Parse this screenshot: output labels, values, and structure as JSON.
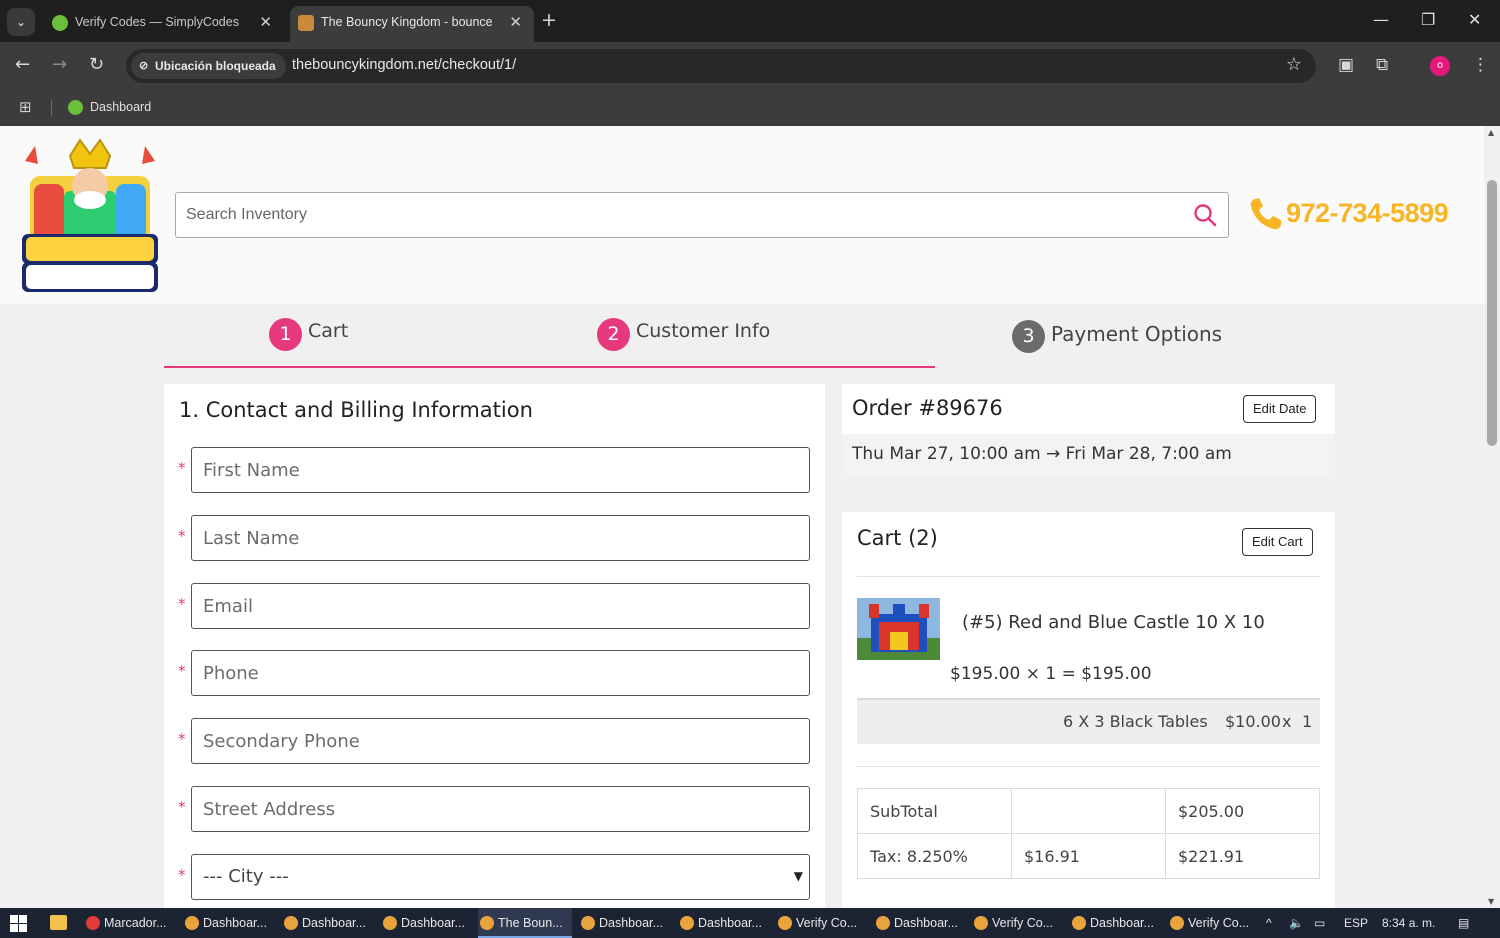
{
  "browser": {
    "tabs": [
      {
        "title": "Verify Codes — SimplyCodes",
        "active": false
      },
      {
        "title": "The Bouncy Kingdom - bounce",
        "active": true
      }
    ],
    "site_chip": "Ubicación bloqueada",
    "url": "thebouncykingdom.net/checkout/1/",
    "bookmark": "Dashboard",
    "profile_initial": "o"
  },
  "header": {
    "search_placeholder": "Search Inventory",
    "phone": "972-734-5899",
    "colors": {
      "accent": "#e6397d",
      "phone": "#f7b523"
    }
  },
  "steps": [
    {
      "num": "1",
      "label": "Cart"
    },
    {
      "num": "2",
      "label": "Customer Info"
    },
    {
      "num": "3",
      "label": "Payment Options"
    }
  ],
  "form": {
    "title": "1. Contact and Billing Information",
    "fields": [
      {
        "placeholder": "First Name",
        "value": ""
      },
      {
        "placeholder": "Last Name",
        "value": ""
      },
      {
        "placeholder": "Email",
        "value": ""
      },
      {
        "placeholder": "Phone",
        "value": ""
      },
      {
        "placeholder": "Secondary Phone",
        "value": ""
      },
      {
        "placeholder": "Street Address",
        "value": ""
      }
    ],
    "city_select": "--- City ---",
    "required_marker": "*"
  },
  "order": {
    "title": "Order #89676",
    "edit_date": "Edit Date",
    "dates": "Thu Mar 27, 10:00 am → Fri Mar 28, 7:00 am"
  },
  "cart": {
    "title": "Cart (2)",
    "edit_cart": "Edit Cart",
    "item": {
      "name": "(#5) Red and Blue Castle 10 X 10",
      "price_line": "$195.00  × 1 =  $195.00"
    },
    "addon": {
      "name": "6 X 3 Black Tables",
      "price": "$10.00",
      "times": "x",
      "qty": "1"
    },
    "totals": [
      [
        "SubTotal",
        "",
        "$205.00"
      ],
      [
        "Tax: 8.250%",
        "$16.91",
        "$221.91"
      ]
    ]
  },
  "taskbar": {
    "items": [
      {
        "label": "Marcador...",
        "active": false,
        "color": "#e03a3a"
      },
      {
        "label": "Dashboar...",
        "active": false,
        "color": "#e8a33c"
      },
      {
        "label": "Dashboar...",
        "active": false,
        "color": "#e8a33c"
      },
      {
        "label": "Dashboar...",
        "active": false,
        "color": "#e8a33c"
      },
      {
        "label": "The Boun...",
        "active": true,
        "color": "#e8a33c"
      },
      {
        "label": "Dashboar...",
        "active": false,
        "color": "#e8a33c"
      },
      {
        "label": "Dashboar...",
        "active": false,
        "color": "#e8a33c"
      },
      {
        "label": "Verify Co...",
        "active": false,
        "color": "#e8a33c"
      },
      {
        "label": "Dashboar...",
        "active": false,
        "color": "#e8a33c"
      },
      {
        "label": "Verify Co...",
        "active": false,
        "color": "#e8a33c"
      },
      {
        "label": "Dashboar...",
        "active": false,
        "color": "#e8a33c"
      },
      {
        "label": "Verify Co...",
        "active": false,
        "color": "#e8a33c"
      }
    ],
    "language": "ESP",
    "time": "8:34 a. m."
  }
}
